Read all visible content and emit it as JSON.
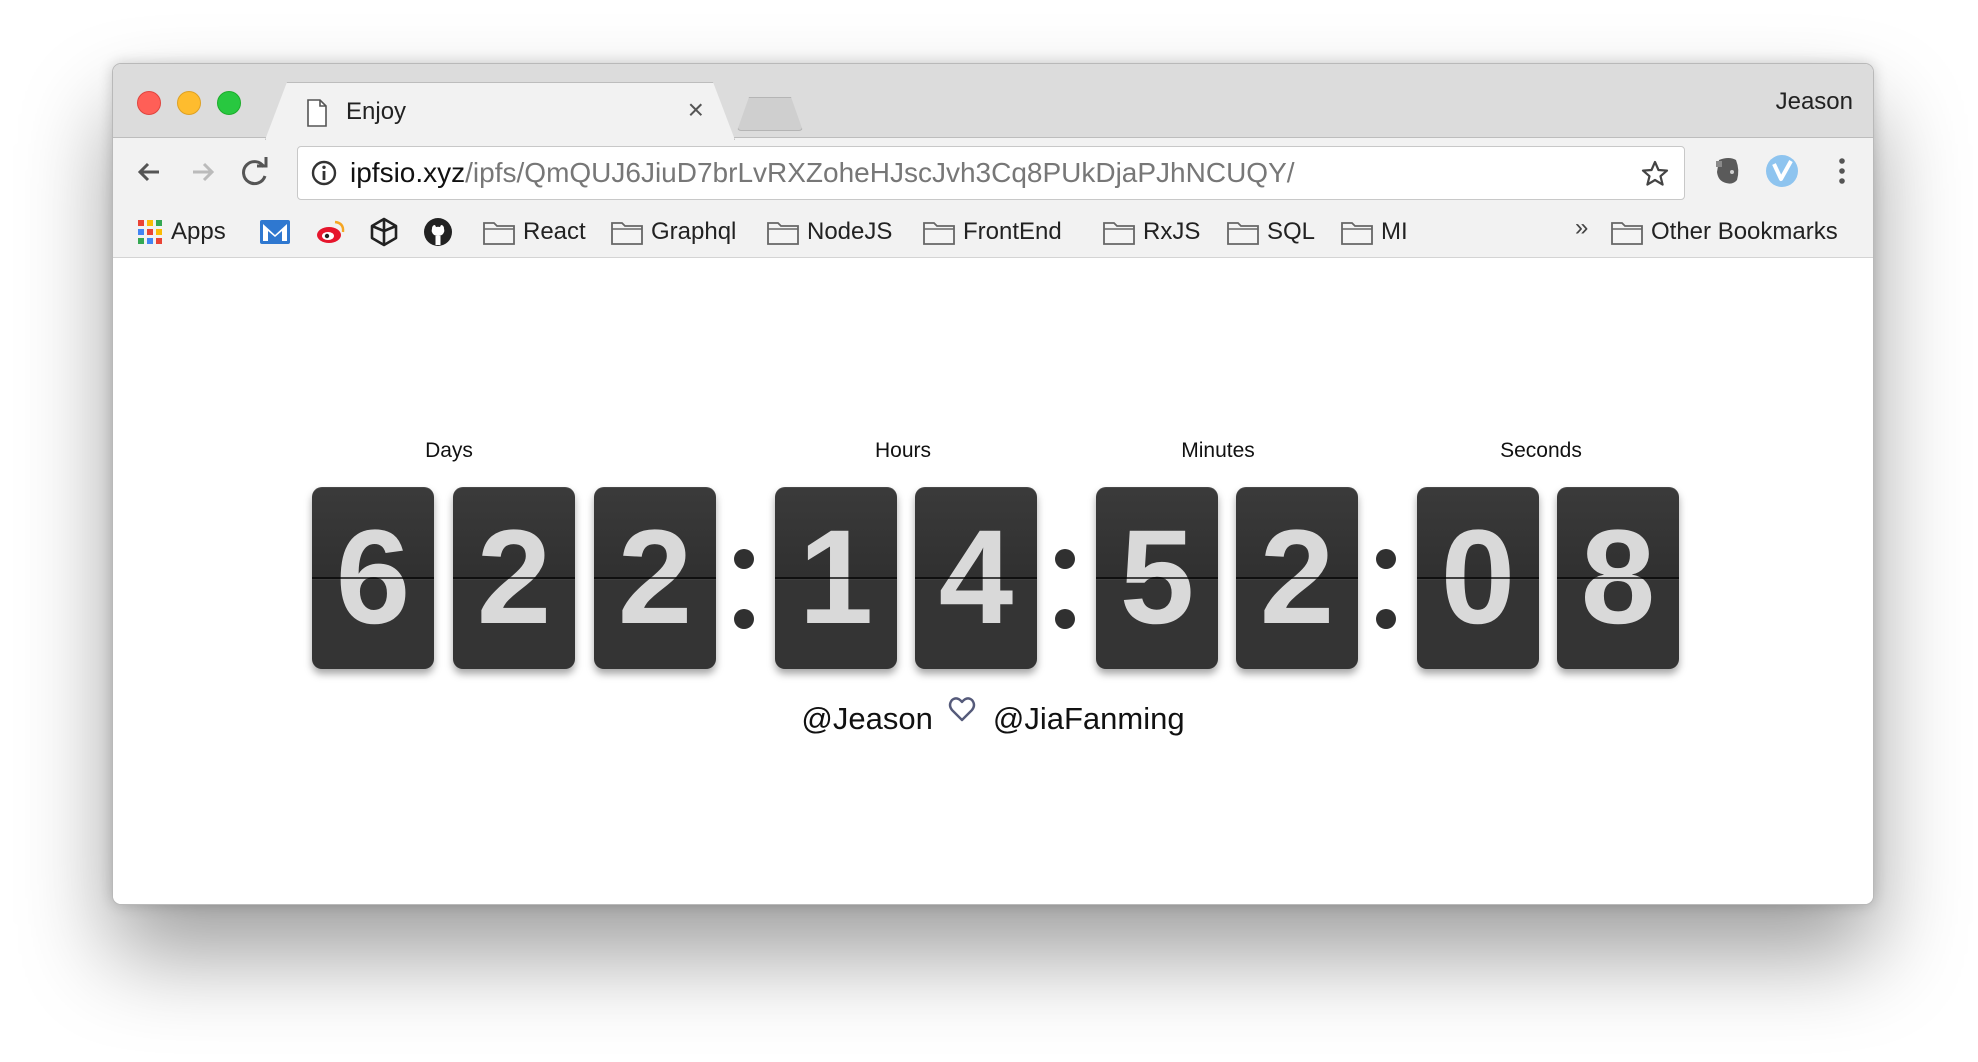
{
  "window": {
    "tab_title": "Enjoy",
    "tab_close": "×",
    "profile_name": "Jeason"
  },
  "toolbar": {
    "url_host": "ipfsio.xyz",
    "url_path": "/ipfs/QmQUJ6JiuD7brLvRXZoheHJscJvh3Cq8PUkDjaPJhNCUQY/"
  },
  "bookmarks": {
    "items": [
      {
        "label": "Apps",
        "icon": "apps-grid-icon"
      },
      {
        "label": "",
        "icon": "mail-icon"
      },
      {
        "label": "",
        "icon": "weibo-icon"
      },
      {
        "label": "",
        "icon": "codepen-icon"
      },
      {
        "label": "",
        "icon": "github-icon"
      },
      {
        "label": "React",
        "icon": "folder-icon"
      },
      {
        "label": "Graphql",
        "icon": "folder-icon"
      },
      {
        "label": "NodeJS",
        "icon": "folder-icon"
      },
      {
        "label": "FrontEnd",
        "icon": "folder-icon"
      },
      {
        "label": "RxJS",
        "icon": "folder-icon"
      },
      {
        "label": "SQL",
        "icon": "folder-icon"
      },
      {
        "label": "MI",
        "icon": "folder-icon"
      }
    ],
    "overflow": "»",
    "other": "Other Bookmarks"
  },
  "countdown": {
    "labels": {
      "days": "Days",
      "hours": "Hours",
      "minutes": "Minutes",
      "seconds": "Seconds"
    },
    "digits": {
      "days": [
        "6",
        "2",
        "2"
      ],
      "hours": [
        "1",
        "4"
      ],
      "minutes": [
        "5",
        "2"
      ],
      "seconds": [
        "0",
        "8"
      ]
    }
  },
  "credits": {
    "left": "@Jeason",
    "right": "@JiaFanming",
    "icon": "heart-icon"
  },
  "colors": {
    "card": "#343434",
    "digit": "#d9d9d9",
    "close_red": "#ff5f57",
    "minimize_yellow": "#febc2e",
    "zoom_green": "#28c840"
  }
}
